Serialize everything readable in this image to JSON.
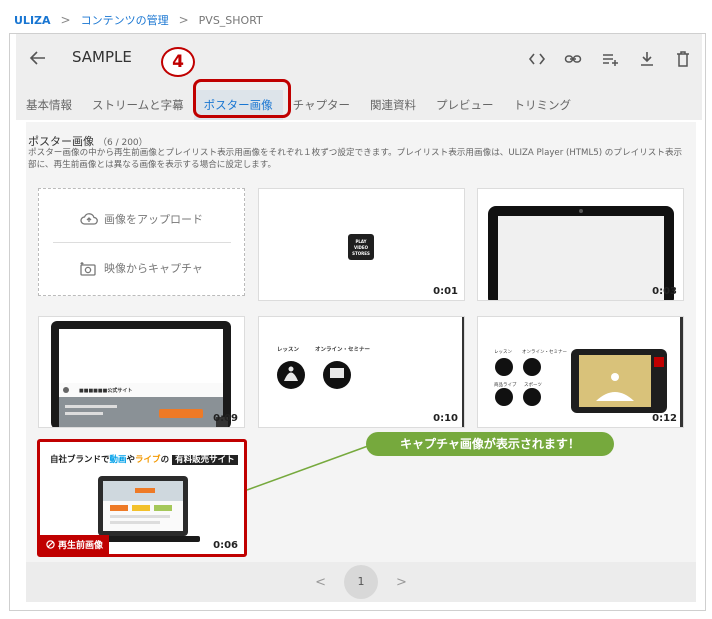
{
  "breadcrumb": {
    "root": "ULIZA",
    "separator": ">",
    "link": "コンテンツの管理",
    "current": "PVS_SHORT"
  },
  "header": {
    "title": "SAMPLE",
    "icons": [
      "back-arrow-icon",
      "code-icon",
      "link-icon",
      "playlist-add-icon",
      "download-icon",
      "delete-icon"
    ]
  },
  "step_badge": "4",
  "tabs": [
    "基本情報",
    "ストリームと字幕",
    "ポスター画像",
    "チャプター",
    "関連資料",
    "プレビュー",
    "トリミング"
  ],
  "active_tab": "ポスター画像",
  "section": {
    "title": "ポスター画像",
    "count": "（6 / 200）",
    "description": "ポスター画像の中から再生前画像とプレイリスト表示用画像をそれぞれ１枚ずつ設定できます。プレイリスト表示用画像は、ULIZA Player (HTML5) のプレイリスト表示部に、再生前画像とは異なる画像を表示する場合に設定します。"
  },
  "upload": {
    "upload_label": "画像をアップロード",
    "capture_label": "映像からキャプチャ"
  },
  "thumbs": [
    {
      "duration": "0:01",
      "logo": "PLAY VIDEO STORES"
    },
    {
      "duration": "0:03"
    },
    {
      "duration": "0:09",
      "site_name": "■■■■■■公式サイト"
    },
    {
      "duration": "0:10",
      "label1": "レッスン",
      "label2": "オンライン・セミナー"
    },
    {
      "duration": "0:12",
      "labels": [
        "レッスン",
        "オンライン・セミナー",
        "商品ライブ",
        "スポーツ"
      ]
    },
    {
      "duration": "0:06",
      "headline_parts": [
        "自社ブランドで",
        "動画",
        "や",
        "ライブ",
        "の",
        "有料販売サイト"
      ],
      "selected_badge": "再生前画像"
    }
  ],
  "callout": "キャプチャ画像が表示されます！",
  "pagination": {
    "prev": "<",
    "page": "1",
    "next": ">"
  },
  "colors": {
    "accent": "#1976d2",
    "highlight": "#c00000",
    "callout": "#76a93d",
    "cyan": "#00a0e9",
    "orange": "#f39800"
  }
}
